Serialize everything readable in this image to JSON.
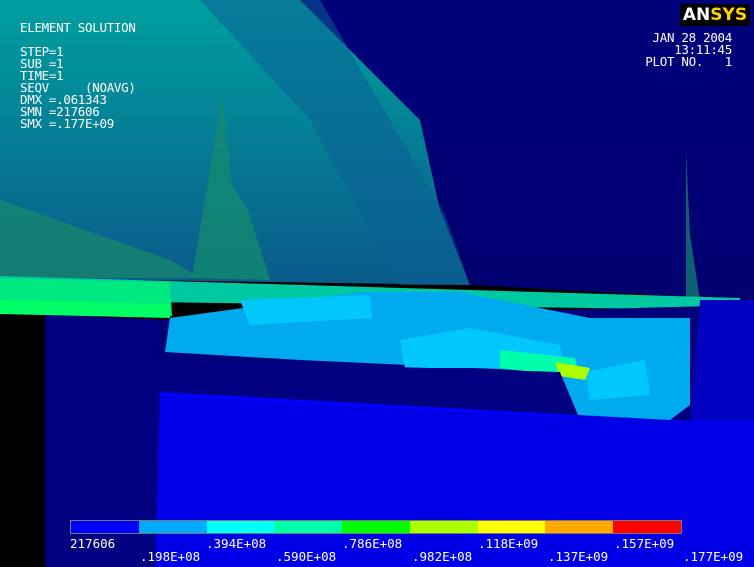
{
  "window": {
    "logo_an": "AN",
    "logo_sys": "SYS"
  },
  "info": {
    "lines": [
      "ELEMENT SOLUTION",
      "",
      "STEP=1",
      "SUB =1",
      "TIME=1",
      "SEQV     (NOAVG)",
      "DMX =.061343",
      "SMN =217606",
      "SMX =.177E+09"
    ]
  },
  "stamp": {
    "date": "JAN 28 2004",
    "time": "13:11:45",
    "plot": "PLOT NO.   1"
  },
  "legend": {
    "colors": [
      "#0000ff",
      "#00aaff",
      "#00ffff",
      "#00ffaa",
      "#00ff00",
      "#aaff00",
      "#ffff00",
      "#ffaa00",
      "#ff0000"
    ],
    "top_labels": [
      "217606",
      ".394E+08",
      ".786E+08",
      ".118E+09",
      ".157E+09"
    ],
    "bottom_labels": [
      ".198E+08",
      ".590E+08",
      ".982E+08",
      ".137E+09",
      ".177E+09"
    ]
  },
  "colors": {
    "navy": "#00005a",
    "deep_blue": "#000099",
    "blue": "#0000ff",
    "teal": "#00aaaa"
  }
}
